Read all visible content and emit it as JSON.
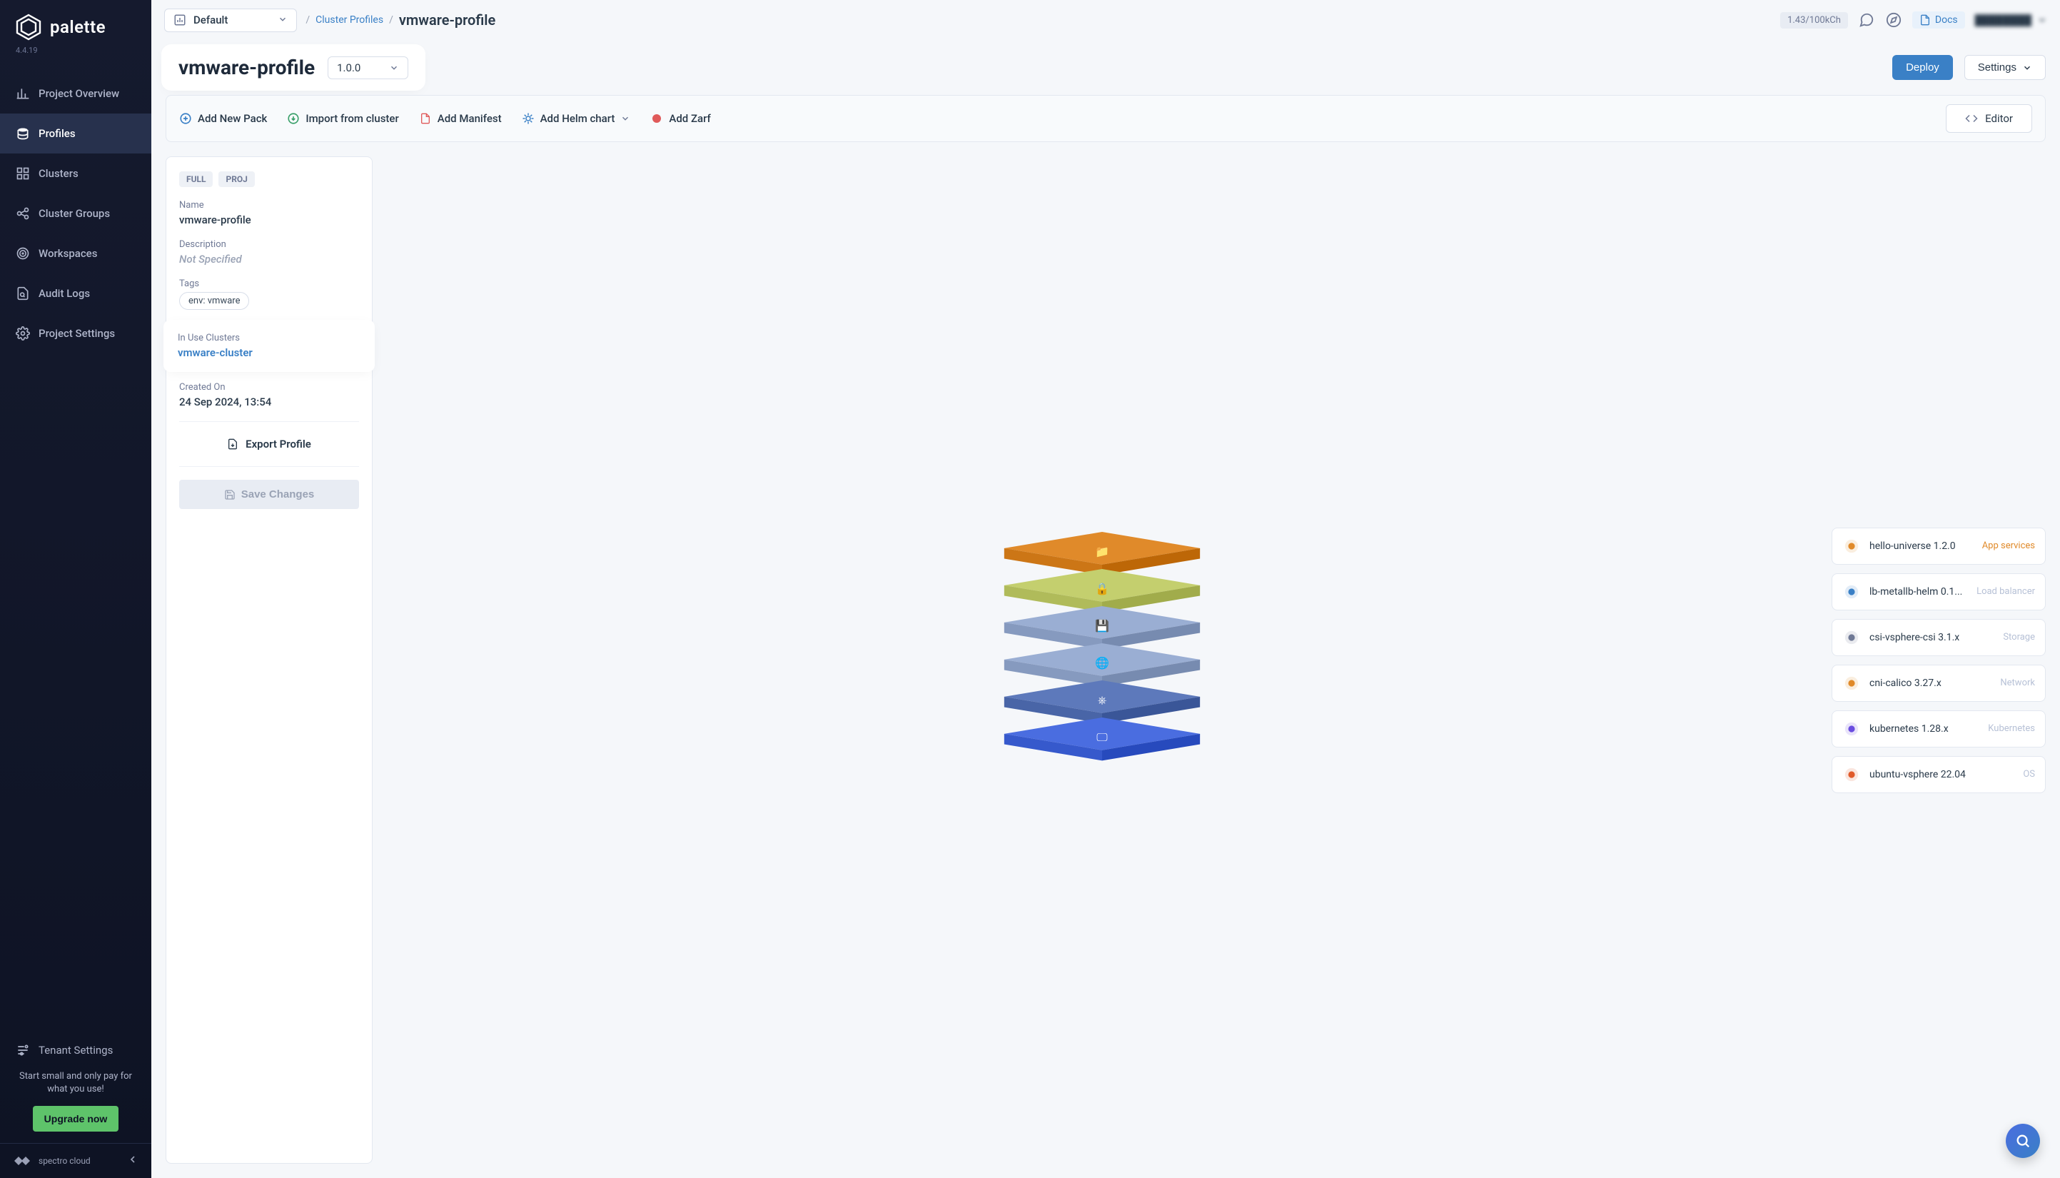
{
  "sidebar": {
    "logo_text": "palette",
    "version": "4.4.19",
    "items": [
      {
        "label": "Project Overview",
        "icon": "chart-bar"
      },
      {
        "label": "Profiles",
        "icon": "stack",
        "active": true
      },
      {
        "label": "Clusters",
        "icon": "grid"
      },
      {
        "label": "Cluster Groups",
        "icon": "share"
      },
      {
        "label": "Workspaces",
        "icon": "target"
      },
      {
        "label": "Audit Logs",
        "icon": "file-search"
      },
      {
        "label": "Project Settings",
        "icon": "gear"
      }
    ],
    "tenant_settings": "Tenant Settings",
    "upgrade_text": "Start small and only pay for what you use!",
    "upgrade_label": "Upgrade now",
    "footer": "spectro cloud"
  },
  "topbar": {
    "org": "Default",
    "breadcrumb_root": "Cluster Profiles",
    "breadcrumb_current": "vmware-profile",
    "usage": "1.43/100kCh",
    "docs_label": "Docs",
    "user_name": "████████"
  },
  "title": {
    "name": "vmware-profile",
    "version": "1.0.0",
    "deploy_label": "Deploy",
    "settings_label": "Settings"
  },
  "actions": {
    "add_pack": "Add New Pack",
    "import": "Import from cluster",
    "add_manifest": "Add Manifest",
    "add_helm": "Add Helm chart",
    "add_zarf": "Add Zarf",
    "editor": "Editor"
  },
  "details": {
    "chips": [
      "FULL",
      "PROJ"
    ],
    "name_label": "Name",
    "name_value": "vmware-profile",
    "desc_label": "Description",
    "desc_value": "Not Specified",
    "tags_label": "Tags",
    "tag_value": "env: vmware",
    "clusters_label": "In Use Clusters",
    "cluster_link": "vmware-cluster",
    "created_label": "Created On",
    "created_value": "24 Sep 2024, 13:54",
    "export_label": "Export Profile",
    "save_label": "Save Changes"
  },
  "packs": [
    {
      "name": "hello-universe 1.2.0",
      "type": "App services",
      "type_color": "#e08a2a",
      "icon_color": "#e08a2a",
      "layer_color": "#e08a2a"
    },
    {
      "name": "lb-metallb-helm 0.1...",
      "type": "Load balancer",
      "type_color": "#b7c1d6",
      "icon_color": "#3a80c6",
      "layer_color": "#c4cf6e"
    },
    {
      "name": "csi-vsphere-csi 3.1.x",
      "type": "Storage",
      "type_color": "#b7c1d6",
      "icon_color": "#6f7995",
      "layer_color": "#9aaed3"
    },
    {
      "name": "cni-calico 3.27.x",
      "type": "Network",
      "type_color": "#b7c1d6",
      "icon_color": "#e08a2a",
      "layer_color": "#9aaed3"
    },
    {
      "name": "kubernetes 1.28.x",
      "type": "Kubernetes",
      "type_color": "#b7c1d6",
      "icon_color": "#6a4de0",
      "layer_color": "#5d79bb"
    },
    {
      "name": "ubuntu-vsphere 22.04",
      "type": "OS",
      "type_color": "#b7c1d6",
      "icon_color": "#e05a2a",
      "layer_color": "#4a6de0"
    }
  ]
}
